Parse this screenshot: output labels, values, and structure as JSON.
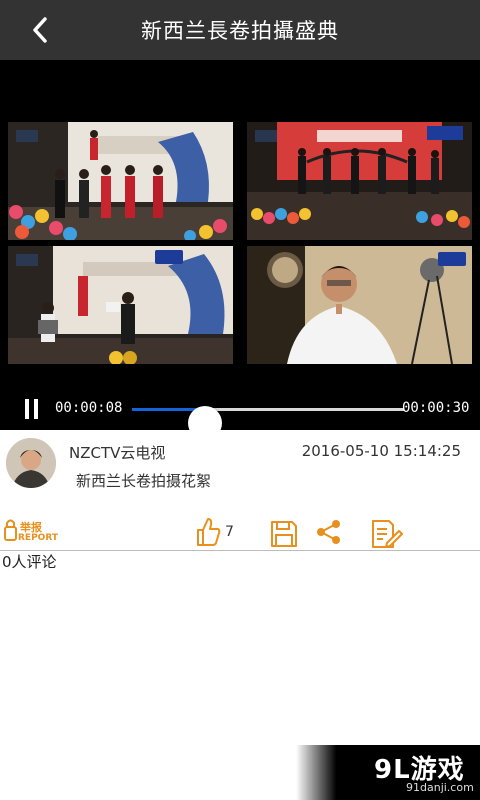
{
  "header": {
    "title": "新西兰長卷拍攝盛典",
    "back_icon": "chevron-left-icon"
  },
  "player": {
    "current_time": "00:00:08",
    "duration": "00:00:30",
    "progress": 0.27,
    "accent_color": "#1565d8",
    "tiles": [
      {
        "name": "stage-performance-qipao"
      },
      {
        "name": "stage-performance-red-backdrop"
      },
      {
        "name": "stage-accordion-speaker"
      },
      {
        "name": "interview-man-white-shirt"
      }
    ]
  },
  "post": {
    "channel": "NZCTV云电视",
    "timestamp": "2016-05-10 15:14:25",
    "description": "新西兰长卷拍摄花絮"
  },
  "actions": {
    "report_label_cn": "举报",
    "report_label_en": "REPORT",
    "like_count": "7",
    "icon_color": "#e8901e"
  },
  "comments": {
    "count_label": "0人评论"
  },
  "watermark": {
    "brand": "9L游戏",
    "site": "91danji.com"
  }
}
